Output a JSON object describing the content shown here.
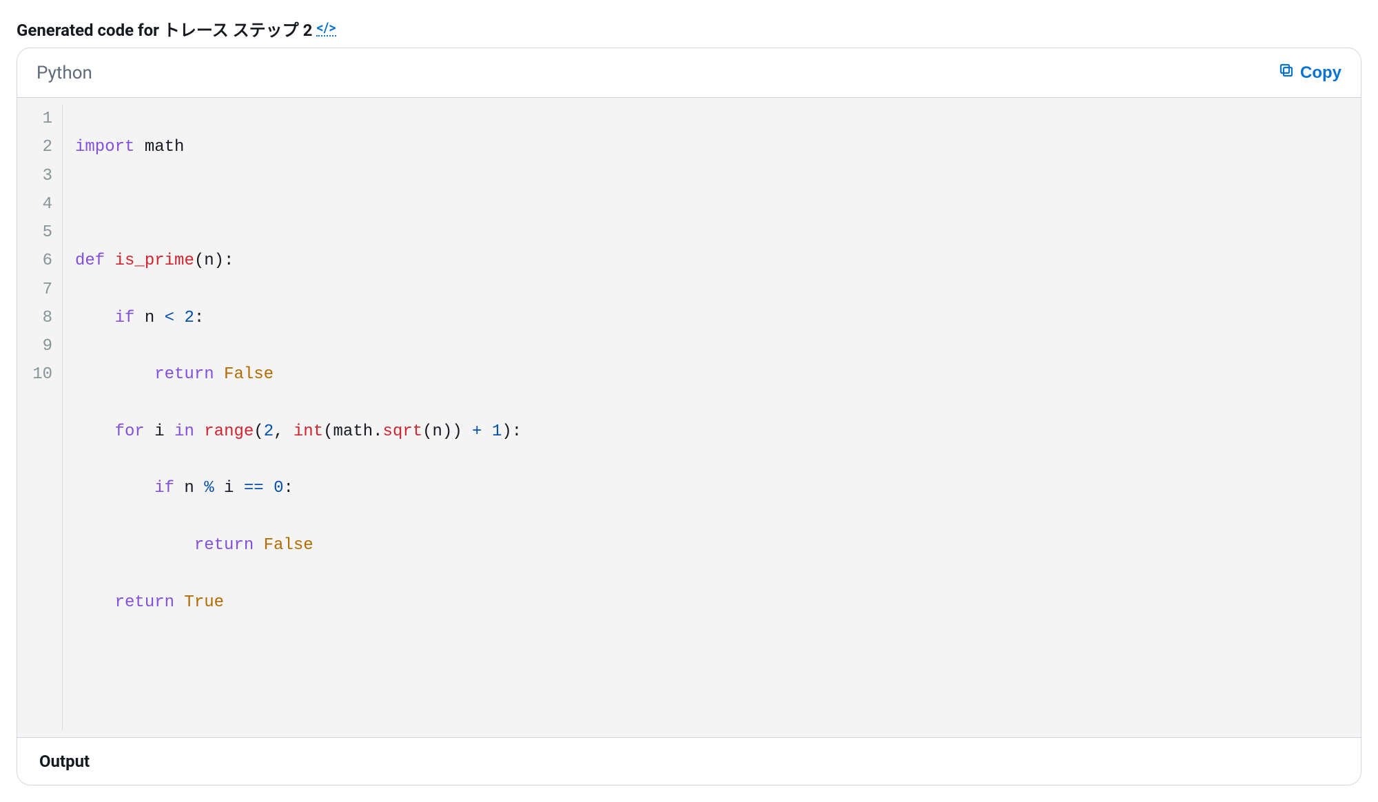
{
  "header": {
    "title_prefix": "Generated code for ",
    "title_trace": "トレース ステップ 2"
  },
  "toolbar": {
    "language": "Python",
    "copy_label": "Copy"
  },
  "code": {
    "line_count": 10,
    "lines": {
      "l1_kw": "import",
      "l1_mod": " math",
      "l3_kw": "def",
      "l3_fn": " is_prime",
      "l3_rest": "(n):",
      "l4_indent": "    ",
      "l4_kw": "if",
      "l4_expr_a": " n ",
      "l4_op": "<",
      "l4_num": " 2",
      "l4_colon": ":",
      "l5_indent": "        ",
      "l5_kw": "return",
      "l5_val": " False",
      "l6_indent": "    ",
      "l6_kw1": "for",
      "l6_i": " i ",
      "l6_kw2": "in",
      "l6_sp": " ",
      "l6_range": "range",
      "l6_open": "(",
      "l6_two": "2",
      "l6_comma": ", ",
      "l6_int": "int",
      "l6_p1": "(math.",
      "l6_sqrt": "sqrt",
      "l6_p2": "(n)) ",
      "l6_plus": "+",
      "l6_sp2": " ",
      "l6_one": "1",
      "l6_close": "):",
      "l7_indent": "        ",
      "l7_kw": "if",
      "l7_a": " n ",
      "l7_pct": "%",
      "l7_b": " i ",
      "l7_eq": "==",
      "l7_sp": " ",
      "l7_zero": "0",
      "l7_colon": ":",
      "l8_indent": "            ",
      "l8_kw": "return",
      "l8_val": " False",
      "l9_indent": "    ",
      "l9_kw": "return",
      "l9_val": " True"
    }
  },
  "output": {
    "label": "Output"
  }
}
